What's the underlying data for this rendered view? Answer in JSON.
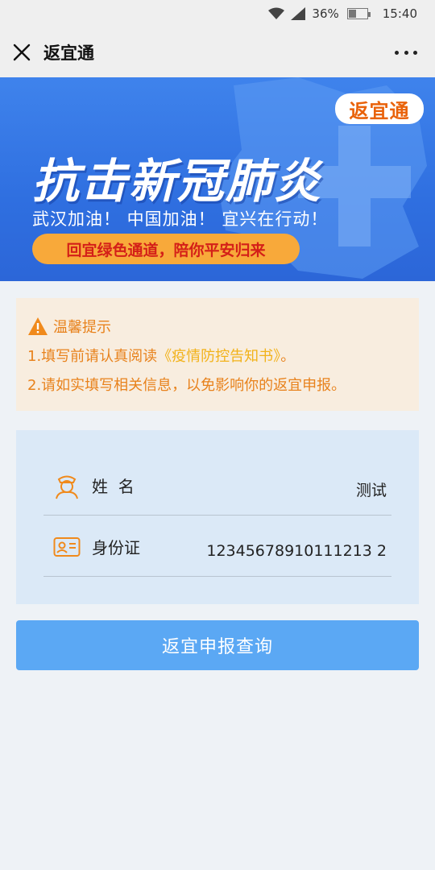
{
  "status_bar": {
    "battery": "36%",
    "time": "15:40",
    "battery_level": 0.36
  },
  "nav": {
    "title": "返宜通"
  },
  "banner": {
    "badge": "返宜通",
    "title": "抗击新冠肺炎",
    "subtitle": "武汉加油！  中国加油！  宜兴在行动！",
    "pill": "回宜绿色通道，陪你平安归来"
  },
  "notice": {
    "heading": "温馨提示",
    "line1_prefix": "1.填写前请认真阅读",
    "line1_link": "《疫情防控告知书》",
    "line1_suffix": "。",
    "line2": "2.请如实填写相关信息，以免影响你的返宜申报。"
  },
  "form": {
    "name_label": "姓  名",
    "name_value": "测试",
    "id_label": "身份证",
    "id_value": "12345678910111213 2"
  },
  "actions": {
    "query_label": "返宜申报查询"
  },
  "colors": {
    "accent_orange": "#e8821c",
    "button_blue": "#5ba8f4",
    "banner_blue": "#3f83ec"
  }
}
